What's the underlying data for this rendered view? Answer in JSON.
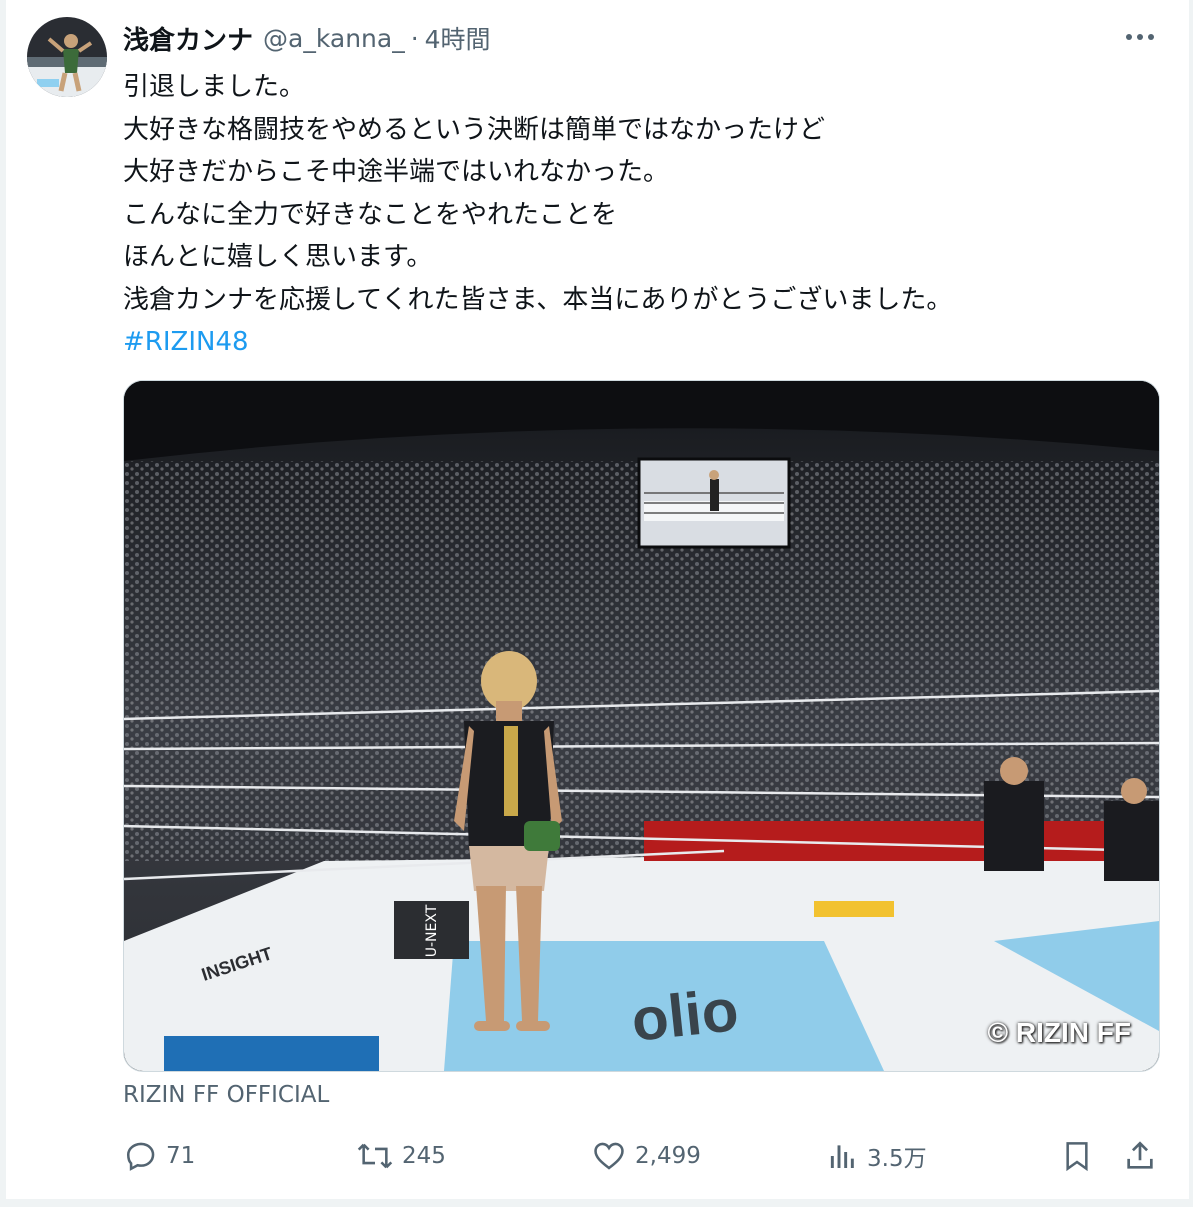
{
  "tweet": {
    "author_name": "浅倉カンナ",
    "handle": "@a_kanna_",
    "separator": "·",
    "time": "4時間",
    "lines": [
      "引退しました。",
      "大好きな格闘技をやめるという決断は簡単ではなかったけど",
      "大好きだからこそ中途半端ではいれなかった。",
      "こんなに全力で好きなことをやれたことを",
      "ほんとに嬉しく思います。",
      "浅倉カンナを応援してくれた皆さま、本当にありがとうございました。"
    ],
    "hashtag": "#RIZIN48",
    "media": {
      "screen_text": "",
      "credit": "© RIZIN FF",
      "mat_logos": [
        "INSIGHT",
        "U-NEXT",
        "olio"
      ]
    },
    "source_label": "RIZIN FF OFFICIAL",
    "actions": {
      "replies": "71",
      "reposts": "245",
      "likes": "2,499",
      "views": "3.5万"
    }
  },
  "colors": {
    "text": "#0f1419",
    "secondary": "#536471",
    "link": "#1d9bf0",
    "border": "#cfd9de"
  },
  "icons": [
    "more-icon",
    "reply-icon",
    "repost-icon",
    "like-icon",
    "views-icon",
    "bookmark-icon",
    "share-icon"
  ]
}
